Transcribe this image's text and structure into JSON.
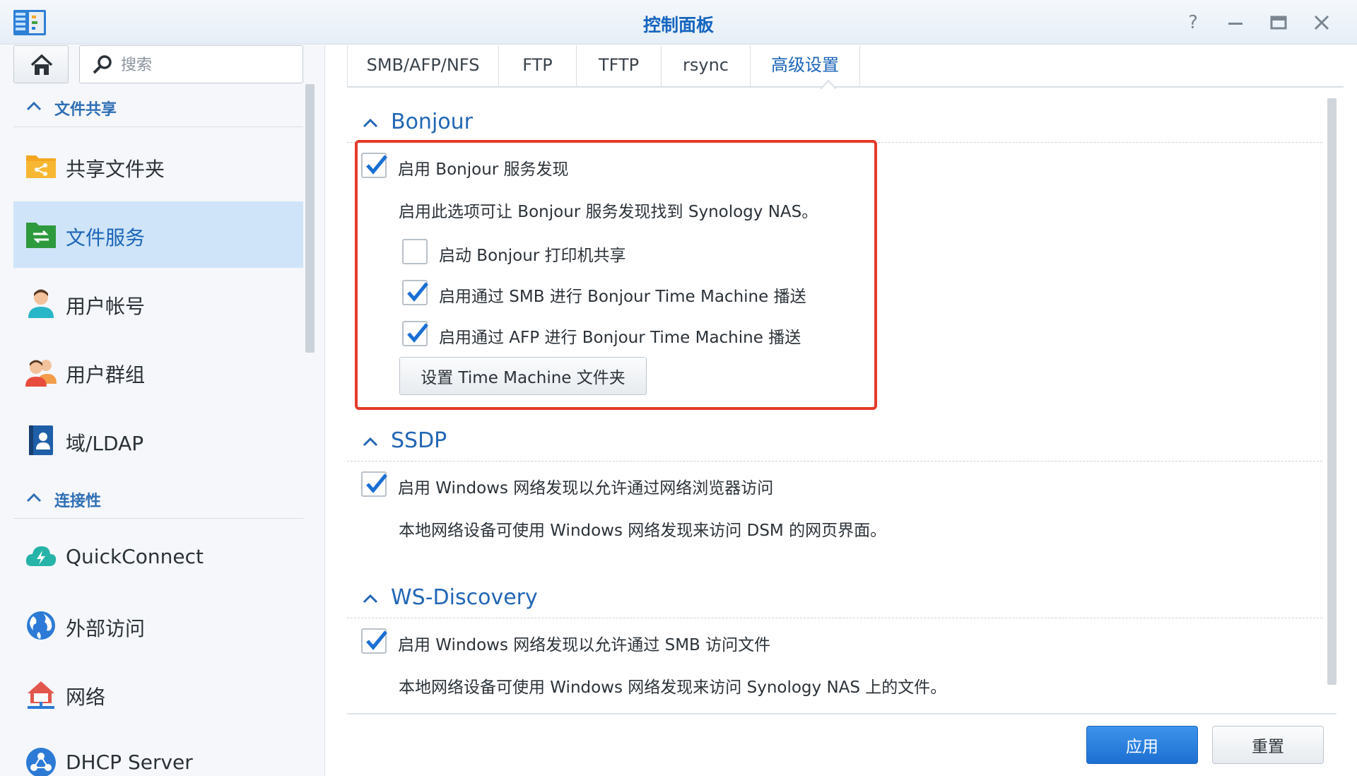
{
  "window": {
    "title": "控制面板",
    "help_icon": "help-icon",
    "minimize_icon": "minimize-icon",
    "maximize_icon": "maximize-icon",
    "close_icon": "close-icon"
  },
  "sidebar": {
    "search_placeholder": "搜索",
    "sections": [
      {
        "label": "文件共享"
      },
      {
        "label": "连接性"
      }
    ],
    "items": [
      {
        "label": "共享文件夹",
        "icon": "shared-folder-icon"
      },
      {
        "label": "文件服务",
        "icon": "file-services-icon",
        "active": true
      },
      {
        "label": "用户帐号",
        "icon": "user-icon"
      },
      {
        "label": "用户群组",
        "icon": "group-icon"
      },
      {
        "label": "域/LDAP",
        "icon": "ldap-icon"
      },
      {
        "label": "QuickConnect",
        "icon": "quickconnect-icon"
      },
      {
        "label": "外部访问",
        "icon": "globe-icon"
      },
      {
        "label": "网络",
        "icon": "network-home-icon"
      },
      {
        "label": "DHCP Server",
        "icon": "dhcp-icon"
      }
    ]
  },
  "tabs": [
    {
      "label": "SMB/AFP/NFS"
    },
    {
      "label": "FTP"
    },
    {
      "label": "TFTP"
    },
    {
      "label": "rsync"
    },
    {
      "label": "高级设置",
      "active": true
    }
  ],
  "groups": {
    "bonjour": {
      "title": "Bonjour",
      "enable_label": "启用 Bonjour 服务发现",
      "enable_checked": true,
      "description": "启用此选项可让 Bonjour 服务发现找到 Synology NAS。",
      "printer_label": "启动 Bonjour 打印机共享",
      "printer_checked": false,
      "smb_tm_label": "启用通过 SMB 进行 Bonjour Time Machine 播送",
      "smb_tm_checked": true,
      "afp_tm_label": "启用通过 AFP 进行 Bonjour Time Machine 播送",
      "afp_tm_checked": true,
      "tm_button": "设置 Time Machine 文件夹"
    },
    "ssdp": {
      "title": "SSDP",
      "enable_label": "启用 Windows 网络发现以允许通过网络浏览器访问",
      "enable_checked": true,
      "description": "本地网络设备可使用 Windows 网络发现来访问 DSM 的网页界面。"
    },
    "wsd": {
      "title": "WS-Discovery",
      "enable_label": "启用 Windows 网络发现以允许通过 SMB 访问文件",
      "enable_checked": true,
      "description": "本地网络设备可使用 Windows 网络发现来访问 Synology NAS 上的文件。"
    }
  },
  "footer": {
    "apply": "应用",
    "reset": "重置"
  },
  "colors": {
    "accent": "#1a64b8",
    "highlight_box": "#e53a2a",
    "active_nav_bg": "#cfe4f8"
  }
}
